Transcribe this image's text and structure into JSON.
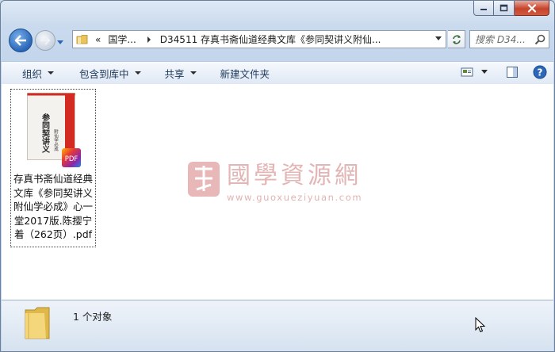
{
  "window": {
    "caption_buttons": [
      "minimize",
      "maximize",
      "close"
    ]
  },
  "address": {
    "chevron": "«",
    "crumb_parent": "国学...",
    "crumb_current": "D34511 存真书斋仙道经典文库《参同契讲义附仙..."
  },
  "search": {
    "placeholder": "搜索 D34..."
  },
  "toolbar": {
    "organize": "组织",
    "include_library": "包含到库中",
    "share": "共享",
    "new_folder": "新建文件夹"
  },
  "file": {
    "name": "存真书斋仙道经典文库《参同契讲义附仙学必成》心一堂2017版.陈撄宁着（262页）.pdf",
    "badge": "PDF",
    "cover_title": "参同契讲义",
    "cover_sub": "附仙学必成"
  },
  "watermark": {
    "cn": "國學資源網",
    "url": "www.guoxueziyuan.com"
  },
  "status": {
    "count": "1 个对象"
  },
  "colors": {
    "accent": "#2a66b8",
    "close_red": "#c6432c",
    "watermark": "#e3b5b5"
  }
}
